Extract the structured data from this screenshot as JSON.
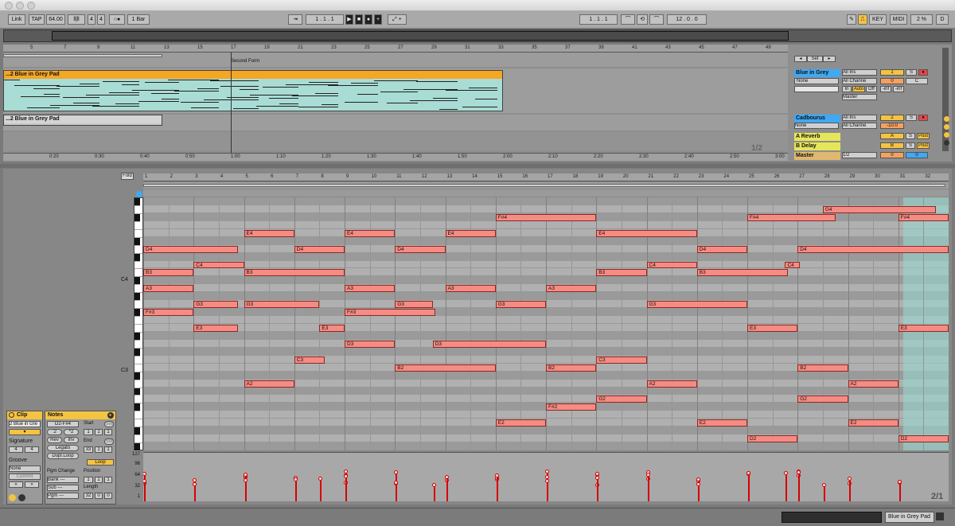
{
  "window": {
    "title": ""
  },
  "control_bar": {
    "link": "Link",
    "tap": "TAP",
    "tempo": "64.00",
    "sig_num": "4",
    "sig_den": "4",
    "quant": "1 Bar",
    "pos1": "1",
    "pos2": "1",
    "pos3": "1",
    "loop1": "1",
    "loop2": "1",
    "loop3": "1",
    "len1": "12",
    "len2": "0",
    "len3": "0",
    "key": "KEY",
    "midi": "MIDI",
    "cpu": "2 %",
    "d": "D"
  },
  "arrangement": {
    "ruler_bars": [
      "5",
      "7",
      "9",
      "11",
      "13",
      "15",
      "17",
      "19",
      "21",
      "23",
      "25",
      "27",
      "29",
      "31",
      "33",
      "35",
      "37",
      "39",
      "41",
      "43",
      "45",
      "47",
      "49"
    ],
    "locator": "Second Form",
    "time_ticks": [
      "0:20",
      "0:30",
      "0:40",
      "0:50",
      "1:00",
      "1:10",
      "1:20",
      "1:30",
      "1:40",
      "1:50",
      "2:00",
      "2:10",
      "2:20",
      "2:30",
      "2:40",
      "2:50",
      "3:00"
    ],
    "clip1": "...2 Blue in Grey Pad",
    "clip2": "...2 Blue in Grey Pad",
    "set": "Set",
    "page": "1/2",
    "tracks": [
      {
        "name": "Blue in Grey",
        "color": "#3fa9f5",
        "input": "All Ins",
        "monitor": "None",
        "channel": "All Channe",
        "num": "1",
        "solo": "S",
        "vol": "0",
        "pan": "C",
        "in": "In",
        "auto": "Auto",
        "off": "Off",
        "inf1": "-inf",
        "inf2": "-inf",
        "out": "Master"
      },
      {
        "name": "Cadbourus",
        "color": "#3fa9f5",
        "input": "All Ins",
        "monitor": "None",
        "channel": "All Channe",
        "num": "2",
        "solo": "S",
        "vol": "-10.0"
      },
      {
        "name": "A Reverb",
        "color": "#e6e65a",
        "letter": "A",
        "solo": "S",
        "post": "Post"
      },
      {
        "name": "B Delay",
        "color": "#e6e65a",
        "letter": "B",
        "solo": "S",
        "post": "Post"
      },
      {
        "name": "Master",
        "color": "#e0b870",
        "cue": "1/2",
        "vol": "0",
        "pan": "0"
      }
    ]
  },
  "clip_panel": {
    "clip_title": "Clip",
    "clip_name": "2 Blue in Gre",
    "signature": "Signature",
    "sig_num": "4",
    "sig_den": "4",
    "groove": "Groove",
    "groove_val": "None",
    "commit": "Commit"
  },
  "notes_panel": {
    "title": "Notes",
    "range": "D2-F#4",
    "half": ":2",
    "double": "*2",
    "rev": "Rev",
    "inv": "Inv",
    "legato": "Legato",
    "dupl": "Dupl.Loop",
    "start": "Start",
    "end": "End",
    "set": "Set",
    "start_vals": [
      "1",
      "1",
      "1"
    ],
    "end_vals": [
      "33",
      "1",
      "1"
    ],
    "loop": "Loop",
    "position": "Position",
    "length": "Length",
    "pos_vals": [
      "1",
      "1",
      "1"
    ],
    "len_vals": [
      "32",
      "0",
      "0"
    ],
    "pgm_change": "Pgm Change",
    "bank": "Bank ---",
    "sub": "Sub ---",
    "pgm": "Pgm ---"
  },
  "editor": {
    "fold": "Fold",
    "bars": [
      "1",
      "2",
      "3",
      "4",
      "5",
      "6",
      "7",
      "8",
      "9",
      "10",
      "11",
      "12",
      "13",
      "14",
      "15",
      "16",
      "17",
      "18",
      "19",
      "20",
      "21",
      "22",
      "23",
      "24",
      "25",
      "26",
      "27",
      "28",
      "29",
      "30",
      "31",
      "32"
    ],
    "c4": "C4",
    "c3": "C3",
    "vel_ticks": [
      "127",
      "96",
      "64",
      "32",
      "1"
    ],
    "page": "2/1",
    "notes": [
      {
        "p": "G4",
        "s": 27,
        "l": 4.5
      },
      {
        "p": "F#4",
        "s": 14,
        "l": 4
      },
      {
        "p": "F#4",
        "s": 24,
        "l": 3.5
      },
      {
        "p": "F#4",
        "s": 30,
        "l": 2
      },
      {
        "p": "E4",
        "s": 4,
        "l": 2
      },
      {
        "p": "E4",
        "s": 8,
        "l": 2
      },
      {
        "p": "E4",
        "s": 12,
        "l": 2
      },
      {
        "p": "E4",
        "s": 18,
        "l": 4
      },
      {
        "p": "D4",
        "s": 0,
        "l": 3.75
      },
      {
        "p": "D4",
        "s": 6,
        "l": 2
      },
      {
        "p": "D4",
        "s": 10,
        "l": 2
      },
      {
        "p": "D4",
        "s": 22,
        "l": 2
      },
      {
        "p": "D4",
        "s": 26,
        "l": 6
      },
      {
        "p": "C4",
        "s": 2,
        "l": 2
      },
      {
        "p": "C4",
        "s": 20,
        "l": 2
      },
      {
        "p": "C4",
        "s": 25.5,
        "l": 0.6
      },
      {
        "p": "B3",
        "s": 0,
        "l": 2
      },
      {
        "p": "B3",
        "s": 4,
        "l": 4
      },
      {
        "p": "B3",
        "s": 18,
        "l": 2
      },
      {
        "p": "B3",
        "s": 22,
        "l": 3.6
      },
      {
        "p": "A3",
        "s": 0,
        "l": 2
      },
      {
        "p": "A3",
        "s": 8,
        "l": 2
      },
      {
        "p": "A3",
        "s": 12,
        "l": 2
      },
      {
        "p": "A3",
        "s": 16,
        "l": 2
      },
      {
        "p": "G3",
        "s": 2,
        "l": 1.75
      },
      {
        "p": "G3",
        "s": 4,
        "l": 3
      },
      {
        "p": "G3",
        "s": 10,
        "l": 1.5
      },
      {
        "p": "G3",
        "s": 14,
        "l": 2
      },
      {
        "p": "G3",
        "s": 20,
        "l": 4
      },
      {
        "p": "F#3",
        "s": 0,
        "l": 2
      },
      {
        "p": "F#3",
        "s": 8,
        "l": 3.6
      },
      {
        "p": "E3",
        "s": 2,
        "l": 1.75
      },
      {
        "p": "E3",
        "s": 7,
        "l": 1
      },
      {
        "p": "E3",
        "s": 24,
        "l": 2
      },
      {
        "p": "E3",
        "s": 30,
        "l": 2
      },
      {
        "p": "D3",
        "s": 8,
        "l": 2
      },
      {
        "p": "D3",
        "s": 11.5,
        "l": 4.5
      },
      {
        "p": "C3",
        "s": 6,
        "l": 1.2
      },
      {
        "p": "C3",
        "s": 18,
        "l": 2
      },
      {
        "p": "B2",
        "s": 10,
        "l": 4
      },
      {
        "p": "B2",
        "s": 16,
        "l": 2
      },
      {
        "p": "B2",
        "s": 26,
        "l": 2
      },
      {
        "p": "A2",
        "s": 4,
        "l": 2
      },
      {
        "p": "A2",
        "s": 20,
        "l": 2
      },
      {
        "p": "A2",
        "s": 28,
        "l": 2
      },
      {
        "p": "G2",
        "s": 18,
        "l": 2
      },
      {
        "p": "G2",
        "s": 26,
        "l": 2
      },
      {
        "p": "F#2",
        "s": 16,
        "l": 2
      },
      {
        "p": "E2",
        "s": 14,
        "l": 2
      },
      {
        "p": "E2",
        "s": 22,
        "l": 2
      },
      {
        "p": "E2",
        "s": 28,
        "l": 2
      },
      {
        "p": "D2",
        "s": 24,
        "l": 2
      },
      {
        "p": "D2",
        "s": 30,
        "l": 2
      }
    ]
  },
  "status": {
    "track": "Blue in Grey Pad"
  }
}
